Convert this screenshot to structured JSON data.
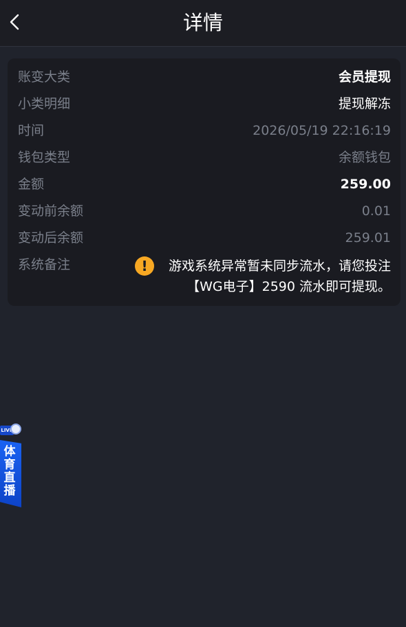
{
  "header": {
    "title": "详情"
  },
  "details": [
    {
      "label": "账变大类",
      "value": "会员提现"
    },
    {
      "label": "小类明细",
      "value": "提现解冻"
    },
    {
      "label": "时间",
      "value": "2026/05/19 22:16:19"
    },
    {
      "label": "钱包类型",
      "value": "余额钱包"
    },
    {
      "label": "金额",
      "value": "259.00"
    },
    {
      "label": "变动前余额",
      "value": "0.01"
    },
    {
      "label": "变动后余额",
      "value": "259.01"
    }
  ],
  "remark": {
    "label": "系统备注",
    "text": "游戏系统异常暂未同步流水，请您投注【WG电子】2590  流水即可提现。"
  },
  "side_badge": {
    "live": "LIVE",
    "text": "体育直播"
  },
  "colors": {
    "warning": "#f7a823",
    "badge_blue": "#1a63f3",
    "card_bg": "#1a1b21",
    "page_bg": "#20232c"
  }
}
